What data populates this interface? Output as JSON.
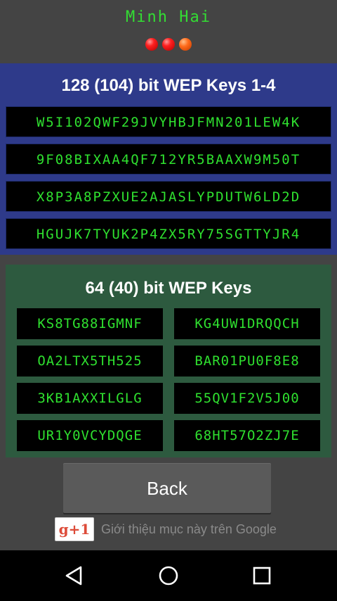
{
  "header": {
    "name": "Minh Hai"
  },
  "status_dots": [
    {
      "color": "#ff2020"
    },
    {
      "color": "#ff2020"
    },
    {
      "color": "#ff6a1a"
    }
  ],
  "wep128": {
    "title": "128 (104) bit WEP Keys 1-4",
    "keys": [
      "W5I102QWF29JVYHBJFMN201LEW4K",
      "9F08BIXAA4QF712YR5BAAXW9M50T",
      "X8P3A8PZXUE2AJASLYPDUTW6LD2D",
      "HGUJK7TYUK2P4ZX5RY75SGTTYJR4"
    ]
  },
  "wep64": {
    "title": "64 (40) bit WEP Keys",
    "keys": [
      "KS8TG88IGMNF",
      "KG4UW1DRQQCH",
      "OA2LTX5TH525",
      "BAR01PU0F8E8",
      "3KB1AXXILGLG",
      "55QV1F2V5J00",
      "UR1Y0VCYDQGE",
      "68HT57O2ZJ7E"
    ]
  },
  "back_button": {
    "label": "Back"
  },
  "gplus": {
    "label": "g+1",
    "text": "Giới thiệu mục này trên Google"
  },
  "colors": {
    "key_text": "#2fe02f",
    "wep128_bg": "#2e3a8a",
    "wep64_bg": "#2d5a3f"
  },
  "navbar": {
    "icons": [
      "back-triangle-icon",
      "home-circle-icon",
      "recents-square-icon"
    ]
  }
}
